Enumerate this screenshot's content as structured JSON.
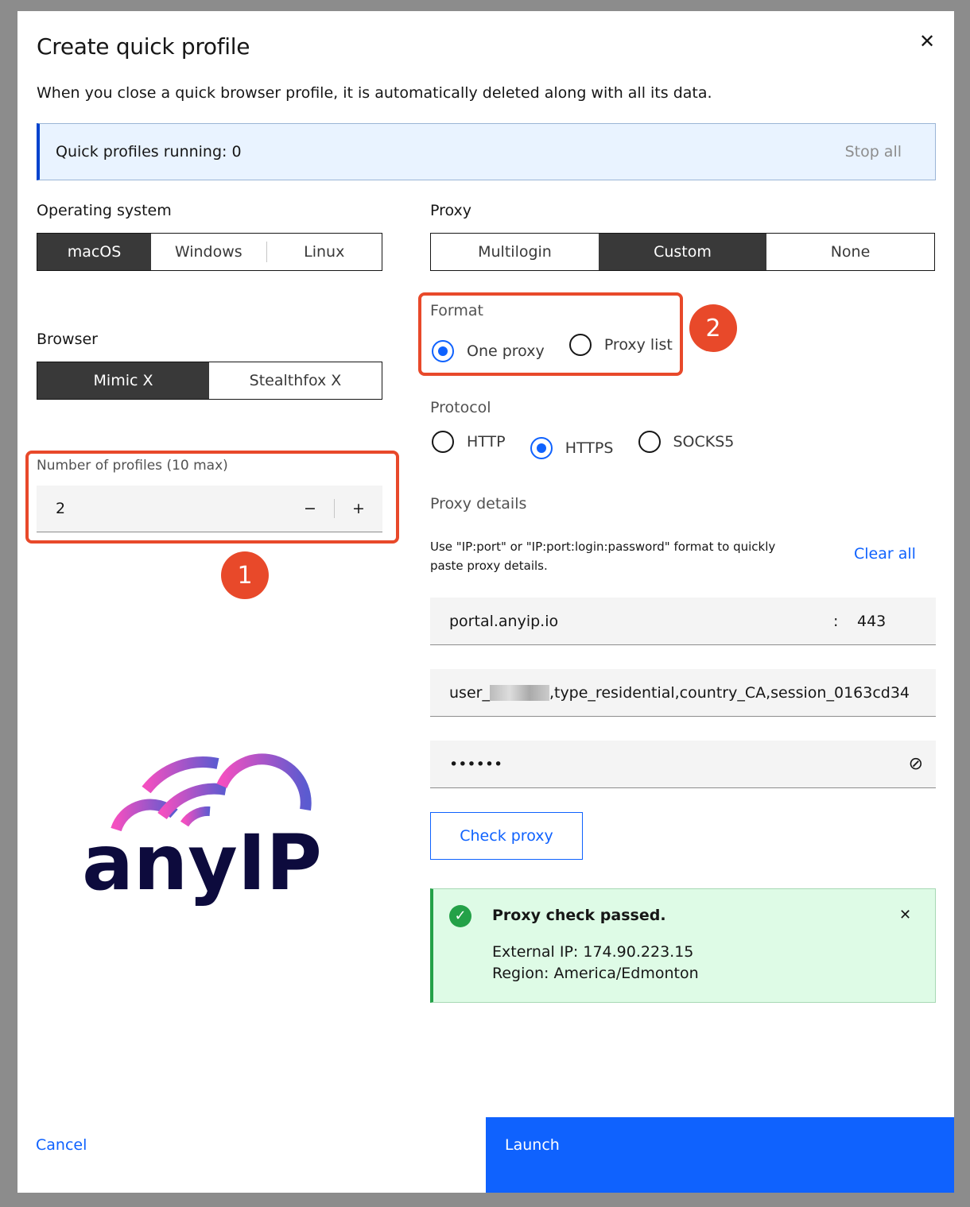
{
  "dialog": {
    "title": "Create quick profile",
    "description": "When you close a quick browser profile, it is automatically deleted along with all its data.",
    "close_icon": "close-icon"
  },
  "banner": {
    "text": "Quick profiles running: 0",
    "stop_all": "Stop all"
  },
  "os": {
    "label": "Operating system",
    "options": [
      "macOS",
      "Windows",
      "Linux"
    ],
    "selected": "macOS"
  },
  "browser": {
    "label": "Browser",
    "options": [
      "Mimic X",
      "Stealthfox X"
    ],
    "selected": "Mimic X"
  },
  "profiles": {
    "label": "Number of profiles (10 max)",
    "value": "2",
    "minus": "−",
    "plus": "+"
  },
  "proxy": {
    "label": "Proxy",
    "options": [
      "Multilogin",
      "Custom",
      "None"
    ],
    "selected": "Custom"
  },
  "format": {
    "label": "Format",
    "options": [
      "One proxy",
      "Proxy list"
    ],
    "selected": "One proxy"
  },
  "protocol": {
    "label": "Protocol",
    "options": [
      "HTTP",
      "HTTPS",
      "SOCKS5"
    ],
    "selected": "HTTPS"
  },
  "details": {
    "label": "Proxy details",
    "hint": "Use \"IP:port\" or \"IP:port:login:password\" format to quickly paste proxy details.",
    "clear_all": "Clear all",
    "host": "portal.anyip.io",
    "separator": ":",
    "port": "443",
    "login_prefix": "user_",
    "login_suffix": ",type_residential,country_CA,session_0163cd34",
    "password": "••••••",
    "eye_icon": "eye-off-icon"
  },
  "check_button": "Check proxy",
  "result": {
    "title": "Proxy check passed.",
    "ip": "External IP: 174.90.223.15",
    "region": "Region: America/Edmonton",
    "status_color": "#24a148"
  },
  "annotations": [
    "1",
    "2"
  ],
  "logo": {
    "text": "anyIP"
  },
  "footer": {
    "cancel": "Cancel",
    "launch": "Launch"
  },
  "colors": {
    "accent": "#0f62fe",
    "highlight": "#e8492a",
    "success_bg": "#defbe6"
  }
}
